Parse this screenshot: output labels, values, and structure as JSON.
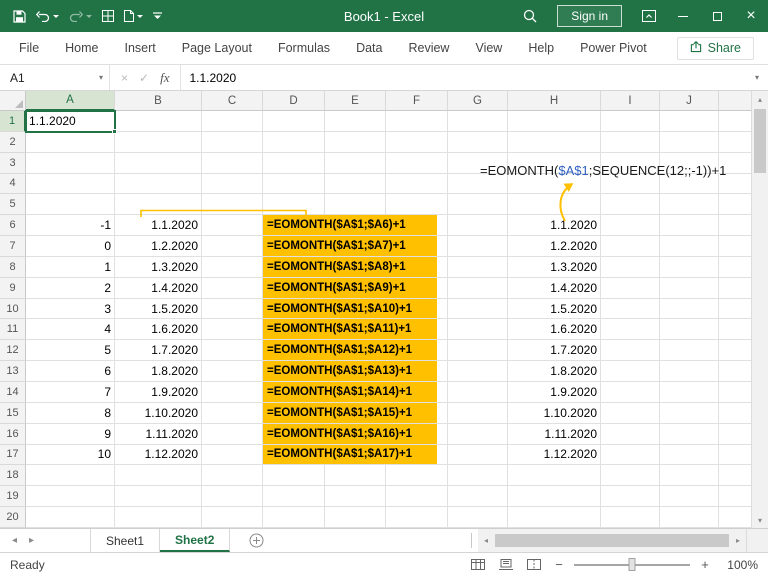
{
  "theme": {
    "accent_green": "#217346",
    "highlight_gold": "#FFC000",
    "formula_ref_blue": "#3060C0"
  },
  "titlebar": {
    "title": "Book1 - Excel",
    "sign_in_label": "Sign in"
  },
  "ribbon": {
    "tabs": [
      "File",
      "Home",
      "Insert",
      "Page Layout",
      "Formulas",
      "Data",
      "Review",
      "View",
      "Help",
      "Power Pivot"
    ],
    "share_label": "Share"
  },
  "formula_bar": {
    "name_box_value": "A1",
    "fx_label": "fx",
    "value": "1.1.2020"
  },
  "sheet": {
    "column_headers": [
      "A",
      "B",
      "C",
      "D",
      "E",
      "F",
      "G",
      "H",
      "I",
      "J"
    ],
    "visible_rows": 20,
    "selected_cell": "A1",
    "a1_value": "1.1.2020",
    "floating_formula": {
      "part1": "=EOMONTH(",
      "ref": "$A$1",
      "part2": ";SEQUENCE(12;;-1))+1"
    },
    "rows": [
      {
        "n": 6,
        "offset": "-1",
        "date": "1.1.2020",
        "formula": "=EOMONTH($A$1;$A6)+1",
        "result": "1.1.2020"
      },
      {
        "n": 7,
        "offset": "0",
        "date": "1.2.2020",
        "formula": "=EOMONTH($A$1;$A7)+1",
        "result": "1.2.2020"
      },
      {
        "n": 8,
        "offset": "1",
        "date": "1.3.2020",
        "formula": "=EOMONTH($A$1;$A8)+1",
        "result": "1.3.2020"
      },
      {
        "n": 9,
        "offset": "2",
        "date": "1.4.2020",
        "formula": "=EOMONTH($A$1;$A9)+1",
        "result": "1.4.2020"
      },
      {
        "n": 10,
        "offset": "3",
        "date": "1.5.2020",
        "formula": "=EOMONTH($A$1;$A10)+1",
        "result": "1.5.2020"
      },
      {
        "n": 11,
        "offset": "4",
        "date": "1.6.2020",
        "formula": "=EOMONTH($A$1;$A11)+1",
        "result": "1.6.2020"
      },
      {
        "n": 12,
        "offset": "5",
        "date": "1.7.2020",
        "formula": "=EOMONTH($A$1;$A12)+1",
        "result": "1.7.2020"
      },
      {
        "n": 13,
        "offset": "6",
        "date": "1.8.2020",
        "formula": "=EOMONTH($A$1;$A13)+1",
        "result": "1.8.2020"
      },
      {
        "n": 14,
        "offset": "7",
        "date": "1.9.2020",
        "formula": "=EOMONTH($A$1;$A14)+1",
        "result": "1.9.2020"
      },
      {
        "n": 15,
        "offset": "8",
        "date": "1.10.2020",
        "formula": "=EOMONTH($A$1;$A15)+1",
        "result": "1.10.2020"
      },
      {
        "n": 16,
        "offset": "9",
        "date": "1.11.2020",
        "formula": "=EOMONTH($A$1;$A16)+1",
        "result": "1.11.2020"
      },
      {
        "n": 17,
        "offset": "10",
        "date": "1.12.2020",
        "formula": "=EOMONTH($A$1;$A17)+1",
        "result": "1.12.2020"
      }
    ]
  },
  "sheet_tabs": {
    "tabs": [
      {
        "label": "Sheet1",
        "active": false
      },
      {
        "label": "Sheet2",
        "active": true
      }
    ]
  },
  "status_bar": {
    "status": "Ready",
    "zoom_level": "100%"
  }
}
